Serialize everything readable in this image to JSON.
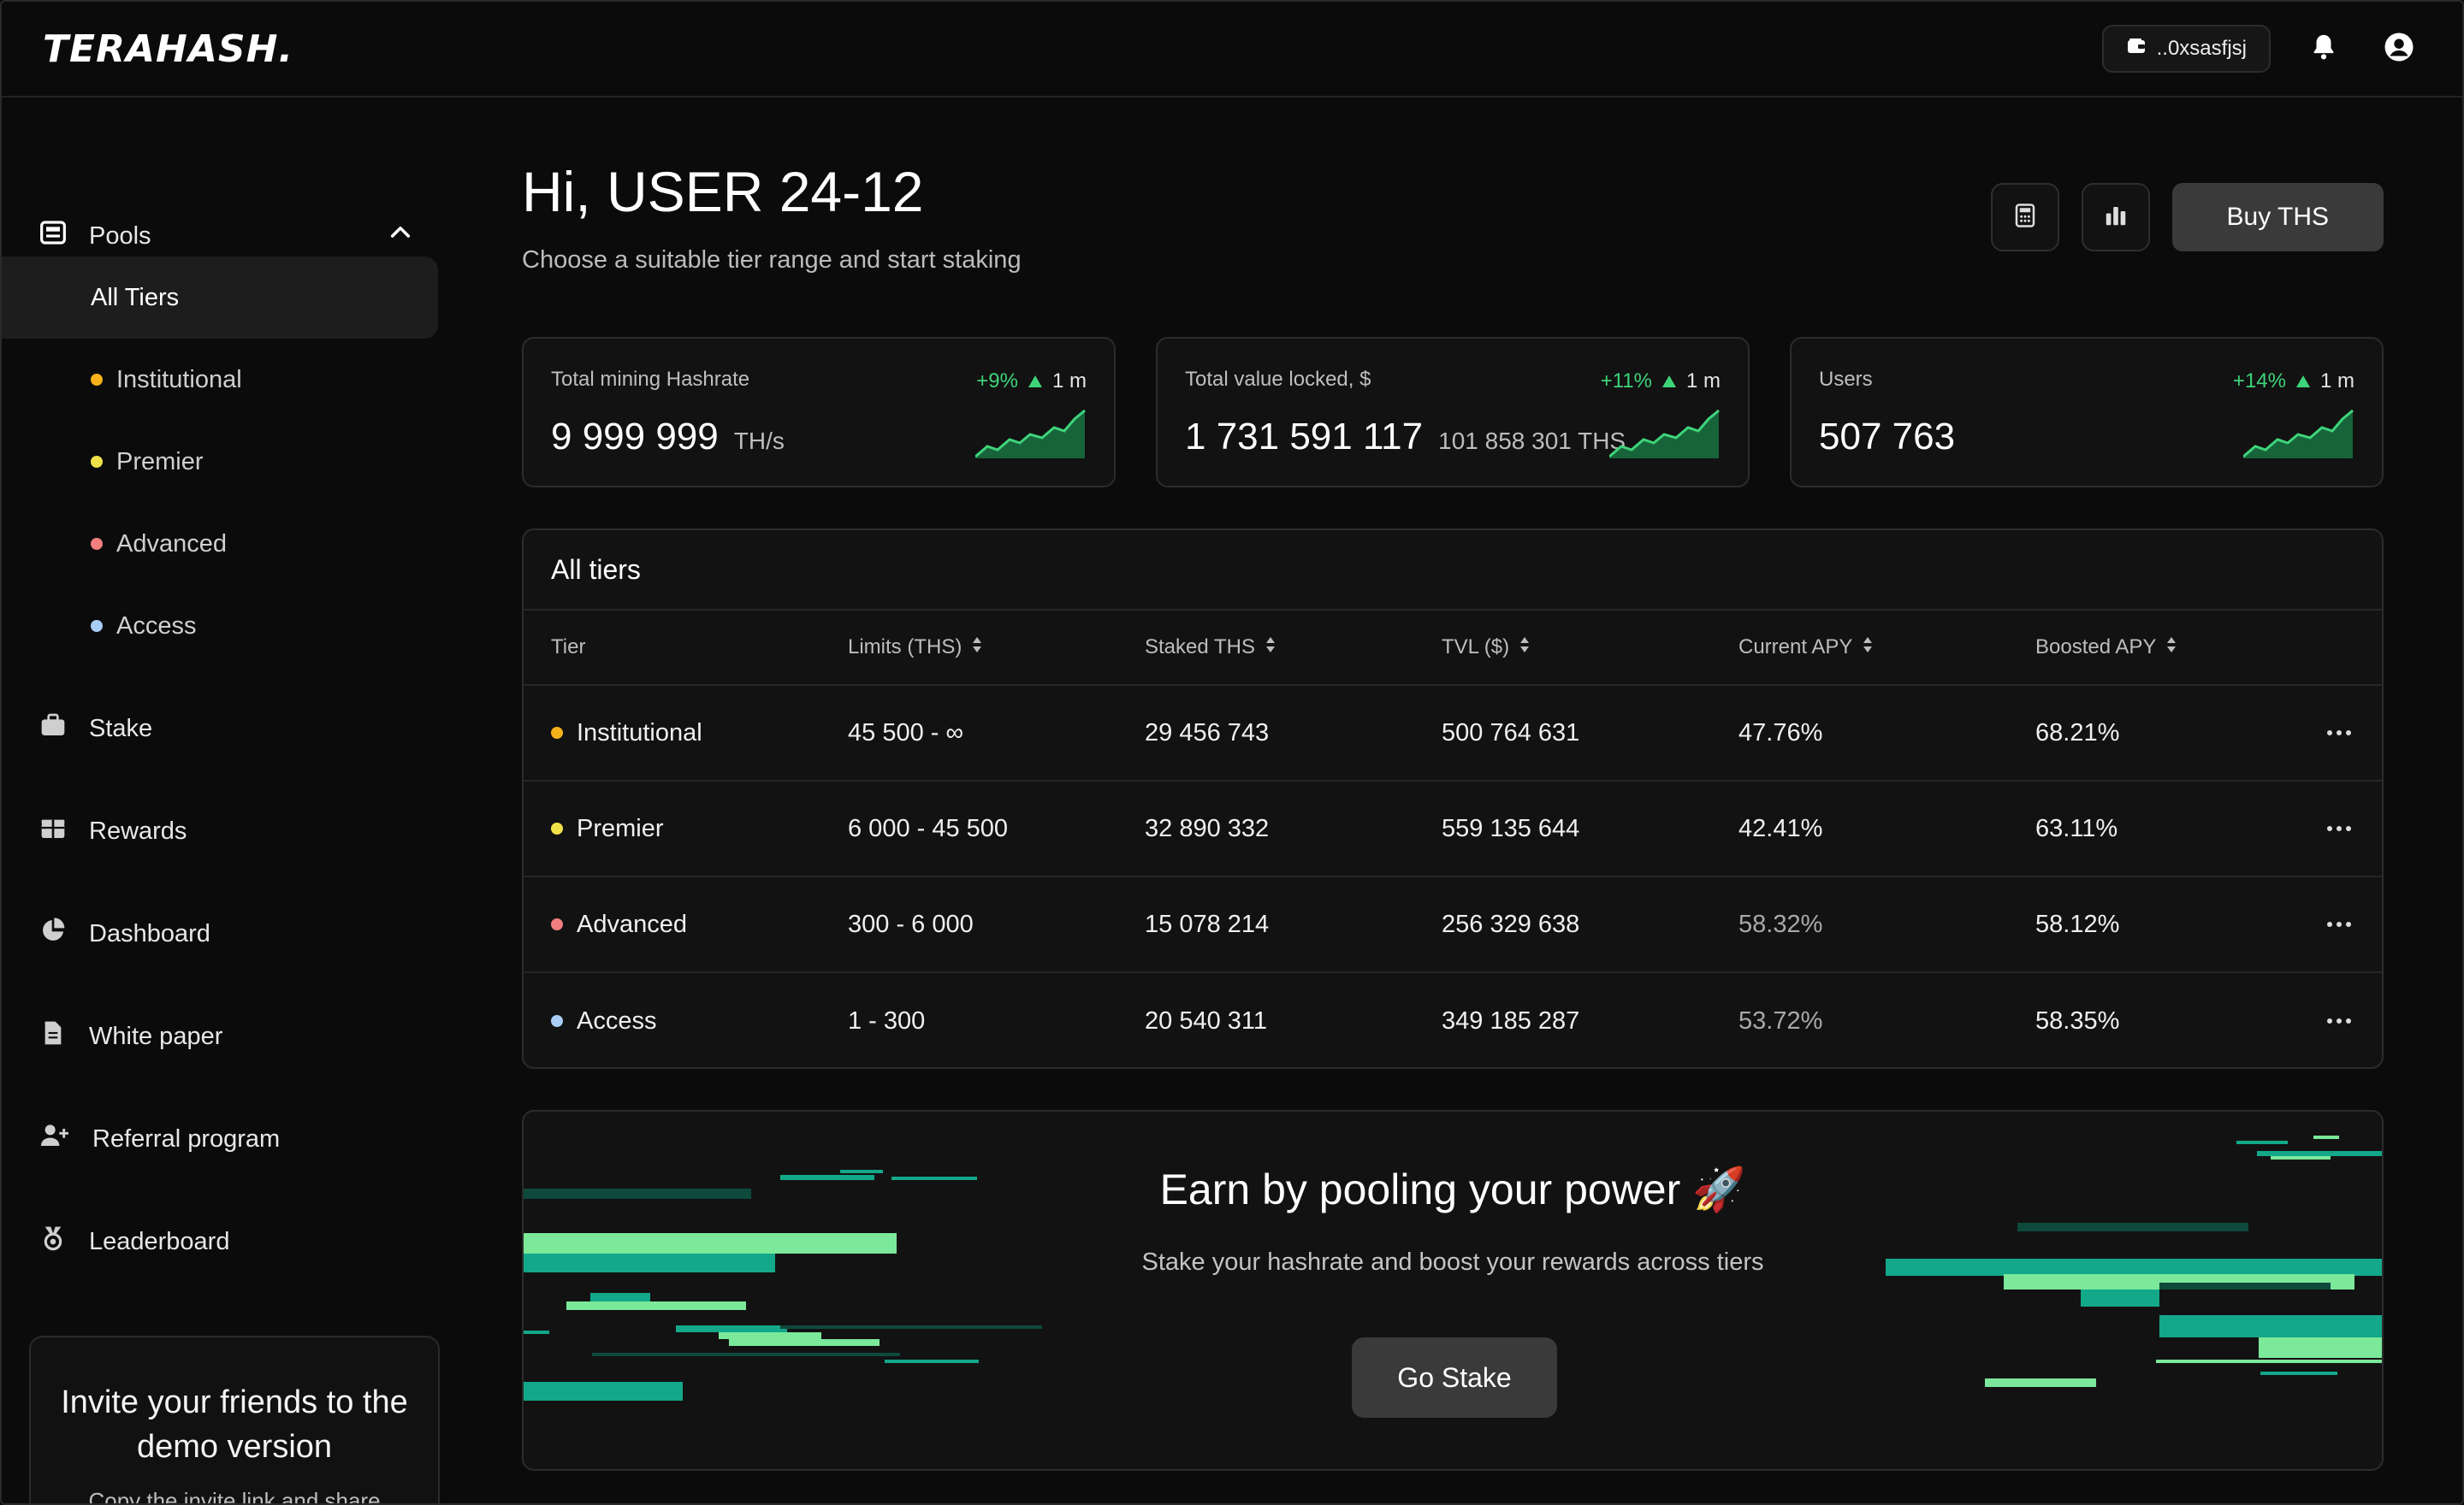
{
  "app": {
    "logo": "TERAHASH."
  },
  "header": {
    "wallet": "..0xsasfjsj"
  },
  "sidebar": {
    "pools_label": "Pools",
    "tiers": [
      {
        "label": "All Tiers",
        "color": ""
      },
      {
        "label": "Institutional",
        "color": "#f5b21a"
      },
      {
        "label": "Premier",
        "color": "#f2e24a"
      },
      {
        "label": "Advanced",
        "color": "#f47f7f"
      },
      {
        "label": "Access",
        "color": "#a9cdf5"
      }
    ],
    "items": [
      {
        "label": "Stake"
      },
      {
        "label": "Rewards"
      },
      {
        "label": "Dashboard"
      },
      {
        "label": "White paper"
      },
      {
        "label": "Referral program"
      },
      {
        "label": "Leaderboard"
      }
    ],
    "invite": {
      "title": "Invite your friends to the demo version",
      "subtitle": "Copy the invite link and share"
    }
  },
  "main": {
    "greeting": "Hi, USER 24-12",
    "subtitle": "Choose a suitable tier range and start staking",
    "buy_label": "Buy THS",
    "stats": [
      {
        "label": "Total mining Hashrate",
        "change": "+9%",
        "period": "1 m",
        "value": "9 999 999",
        "unit": "TH/s"
      },
      {
        "label": "Total value locked, $",
        "change": "+11%",
        "period": "1 m",
        "value": "1 731 591 117",
        "unit": "101 858 301 THS"
      },
      {
        "label": "Users",
        "change": "+14%",
        "period": "1 m",
        "value": "507 763",
        "unit": ""
      }
    ],
    "tiers_table": {
      "title": "All tiers",
      "columns": [
        "Tier",
        "Limits (THS)",
        "Staked THS",
        "TVL ($)",
        "Current APY",
        "Boosted APY"
      ],
      "rows": [
        {
          "tier": "Institutional",
          "limits": "45 500 - ∞",
          "staked": "29 456 743",
          "tvl": "500 764 631",
          "current_apy": "47.76%",
          "boosted_apy": "68.21%"
        },
        {
          "tier": "Premier",
          "limits": "6 000 - 45 500",
          "staked": "32 890 332",
          "tvl": "559 135 644",
          "current_apy": "42.41%",
          "boosted_apy": "63.11%"
        },
        {
          "tier": "Advanced",
          "limits": "300 - 6 000",
          "staked": "15 078 214",
          "tvl": "256 329 638",
          "current_apy": "58.32%",
          "boosted_apy": "58.12%"
        },
        {
          "tier": "Access",
          "limits": "1 - 300",
          "staked": "20 540 311",
          "tvl": "349 185 287",
          "current_apy": "53.72%",
          "boosted_apy": "58.35%"
        }
      ]
    },
    "promo": {
      "title": "Earn by pooling your power 🚀",
      "subtitle": "Stake your hashrate and boost your rewards across tiers",
      "button": "Go Stake"
    }
  },
  "colors": {
    "accent_green": "#3ed47a",
    "bar_green_light": "#7be89a",
    "bar_teal": "#13a88a"
  }
}
